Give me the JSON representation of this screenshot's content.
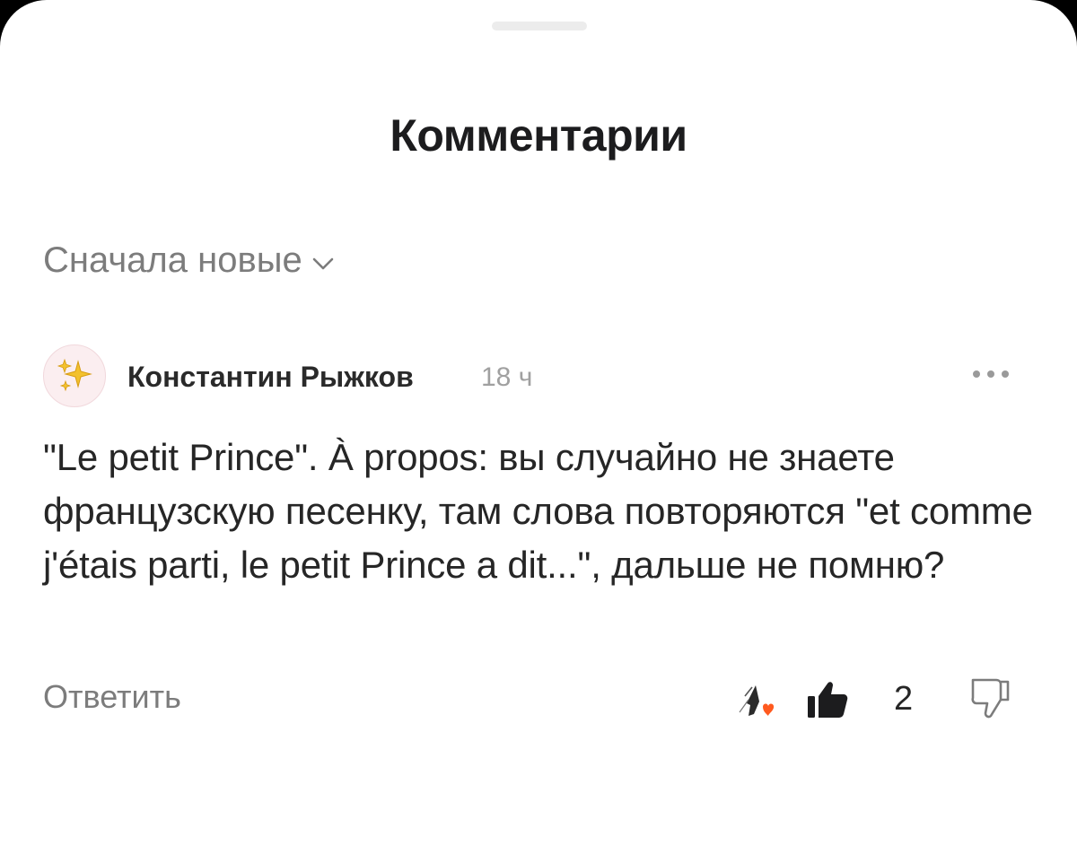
{
  "header": {
    "title": "Комментарии"
  },
  "sort": {
    "label": "Сначала новые",
    "icon": "chevron-down-icon"
  },
  "comment": {
    "avatar_icon": "sparkles-icon",
    "author": "Константин Рыжков",
    "time": "18 ч",
    "text": "\"Le petit Prince\". À propos: вы случайно не знаете французскую песенку, там слова повторяются \"et comme j'étais parti, le petit Prince a dit...\", дальше не помню?",
    "reply_label": "Ответить",
    "like_count": "2",
    "reaction_heart_color": "#ff5a1f"
  },
  "colors": {
    "sheet_bg": "#ffffff",
    "title": "#1c1c1e",
    "muted": "#7c7c7c",
    "avatar_bg": "#fbeef0",
    "sparkle": "#e8b923"
  }
}
